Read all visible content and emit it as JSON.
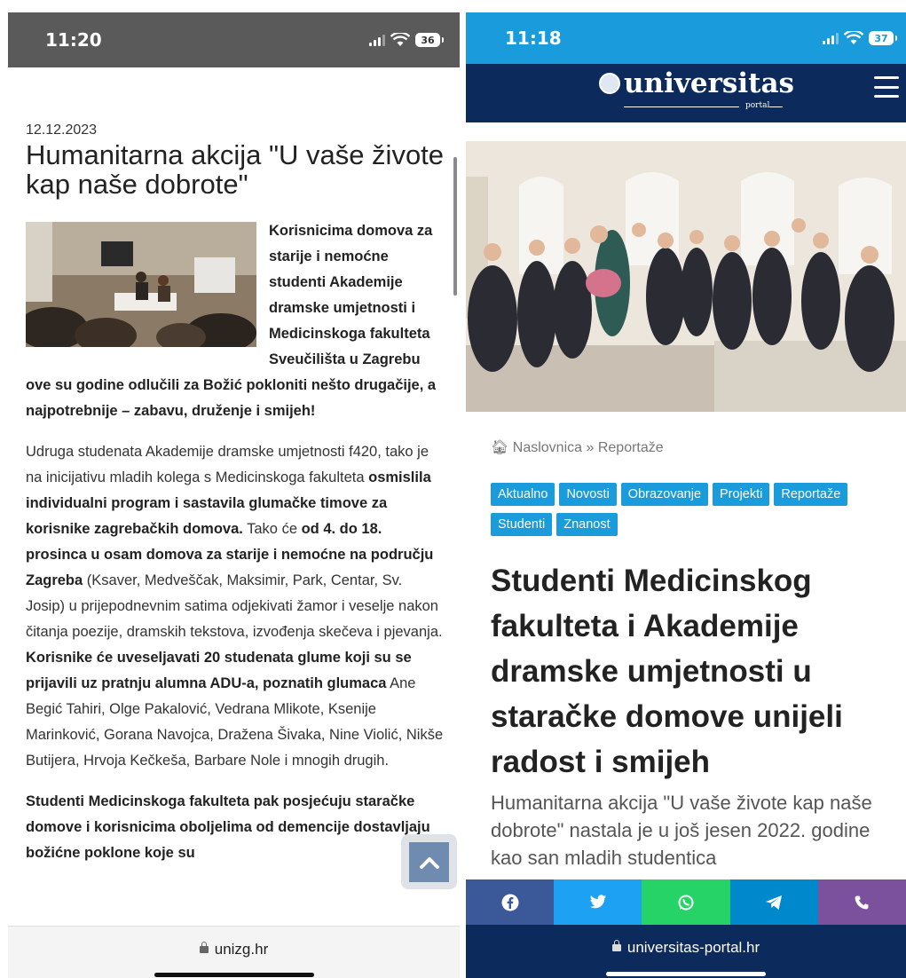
{
  "left": {
    "status_bar": {
      "time": "11:20",
      "battery": "36"
    },
    "article": {
      "date": "12.12.2023",
      "title": "Humanitarna akcija \"U vaše živote kap naše dobrote\"",
      "lead": "Korisnicima domova za starije i nemoćne studenti Akademije dramske umjetnosti i Medicinskoga fakulteta Sveučilišta u Zagrebu ove su godine odlučili za Božić pokloniti nešto drugačije, a najpotrebnije – zabavu, druženje i smijeh!",
      "p1": [
        "Udruga studenata Akademije dramske umjetnosti f420, tako je na inicijativu mladih kolega s Medicinskoga fakulteta ",
        "osmislila individualni program i sastavila glumačke timove za korisnike zagrebačkih domova.",
        " Tako će ",
        "od 4. do 18. prosinca u osam domova za starije i nemoćne na području Zagreba",
        " (Ksaver, Medveščak, Maksimir, Park, Centar, Sv. Josip) u prijepodnevnim satima odjekivati žamor i veselje nakon čitanja poezije, dramskih tekstova, izvođenja skečeva i pjevanja. ",
        "Korisnike će uveseljavati 20 studenata glume koji su se prijavili uz pratnju alumna ADU-a, poznatih glumaca",
        " Ane Begić Tahiri, Olge Pakalović, Vedrana Mlikote, Ksenije Marinković, Gorana Navojca, Dražena Šivaka, Nine Violić, Nikše Butijera, Hrvoja Kečkeša, Barbare Nole i mnogih drugih."
      ],
      "p2": "Studenti Medicinskoga fakulteta pak posjećuju staračke domove i korisnicima oboljelima od demencije dostavljaju božićne poklone koje su"
    },
    "address": "unizg.hr"
  },
  "right": {
    "status_bar": {
      "time": "11:18",
      "battery": "37"
    },
    "logo": {
      "name": "universitas",
      "sub": "portal"
    },
    "breadcrumb": {
      "home": "Naslovnica",
      "sep": "»",
      "current": "Reportaže"
    },
    "tags": [
      "Aktualno",
      "Novosti",
      "Obrazovanje",
      "Projekti",
      "Reportaže",
      "Studenti",
      "Znanost"
    ],
    "title": "Studenti Medicinskog fakulteta i Akademije dramske umjetnosti u staračke domove unijeli radost i smijeh",
    "excerpt": "Humanitarna akcija \"U vaše živote kap naše dobrote\" nastala je u još jesen 2022. godine kao san mladih studentica",
    "share": [
      {
        "icon": "facebook-icon",
        "color": "#3b5998"
      },
      {
        "icon": "twitter-icon",
        "color": "#1da1f2"
      },
      {
        "icon": "whatsapp-icon",
        "color": "#25d366"
      },
      {
        "icon": "telegram-icon",
        "color": "#0088cc"
      },
      {
        "icon": "viber-icon",
        "color": "#7b519d"
      }
    ],
    "address": "universitas-portal.hr"
  }
}
